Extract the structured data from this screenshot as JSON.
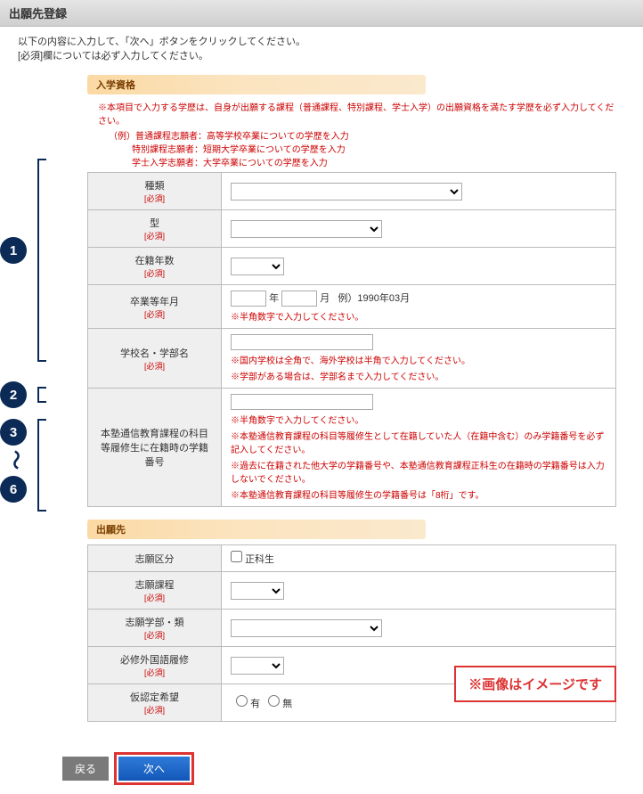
{
  "titlebar": {
    "title": "出願先登録"
  },
  "intro": {
    "line1": "以下の内容に入力して、「次へ」ボタンをクリックしてください。",
    "line2": "[必須]欄については必ず入力してください。"
  },
  "markers": {
    "m1": "1",
    "m2": "2",
    "m3": "3",
    "tilde": "〜",
    "m6": "6"
  },
  "section1": {
    "heading": "入学資格",
    "note": "※本項目で入力する学歴は、自身が出願する課程（普通課程、特別課程、学士入学）の出願資格を満たす学歴を必ず入力してください。",
    "ex1": "（例）普通課程志願者：高等学校卒業についての学歴を入力",
    "ex2": "特別課程志願者：短期大学卒業についての学歴を入力",
    "ex3": "学士入学志願者：大学卒業についての学歴を入力",
    "rows": {
      "r1": {
        "label": "種類",
        "req": "[必須]"
      },
      "r2": {
        "label": "型",
        "req": "[必須]"
      },
      "r3": {
        "label": "在籍年数",
        "req": "[必須]"
      },
      "r4": {
        "label": "卒業等年月",
        "req": "[必須]",
        "y": "年",
        "m": "月",
        "ex": "例）1990年03月",
        "hint": "※半角数字で入力してください。"
      },
      "r5": {
        "label": "学校名・学部名",
        "req": "[必須]",
        "hint1": "※国内学校は全角で、海外学校は半角で入力してください。",
        "hint2": "※学部がある場合は、学部名まで入力してください。"
      },
      "r6": {
        "label": "本塾通信教育課程の科目等履修生に在籍時の学籍番号",
        "hint1": "※半角数字で入力してください。",
        "hint2": "※本塾通信教育課程の科目等履修生として在籍していた人（在籍中含む）のみ学籍番号を必ず記入してください。",
        "hint3": "※過去に在籍された他大学の学籍番号や、本塾通信教育課程正科生の在籍時の学籍番号は入力しないでください。",
        "hint4": "※本塾通信教育課程の科目等履修生の学籍番号は「8桁」です。"
      }
    }
  },
  "section2": {
    "heading": "出願先",
    "rows": {
      "r1": {
        "label": "志願区分",
        "chk": "正科生"
      },
      "r2": {
        "label": "志願課程",
        "req": "[必須]"
      },
      "r3": {
        "label": "志願学部・類",
        "req": "[必須]"
      },
      "r4": {
        "label": "必修外国語履修",
        "req": "[必須]"
      },
      "r5": {
        "label": "仮認定希望",
        "req": "[必須]",
        "opt1": "有",
        "opt2": "無"
      }
    }
  },
  "buttons": {
    "back": "戻る",
    "next": "次へ"
  },
  "overlay": "※画像はイメージです"
}
